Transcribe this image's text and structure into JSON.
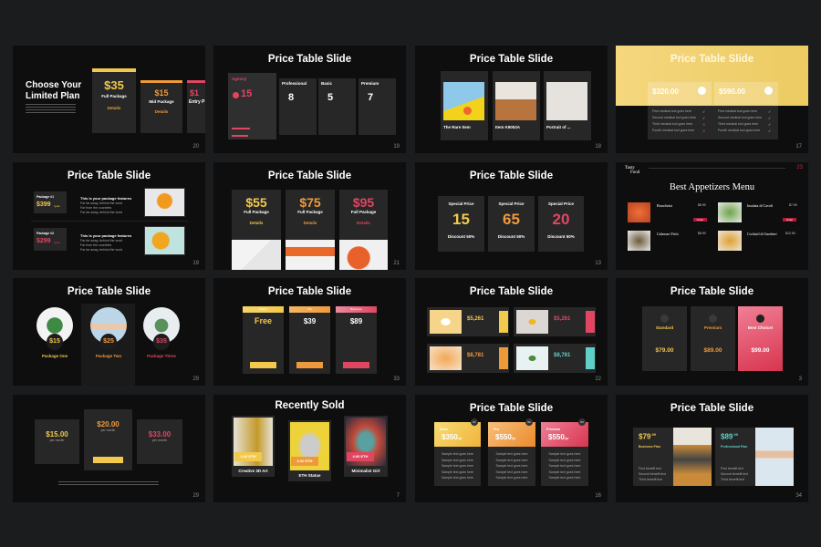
{
  "colors": {
    "background": "#1b1c1e",
    "slide": "#0e0e0f",
    "card": "#272728",
    "yellow": "#f2c94c",
    "orange": "#ef9a3a",
    "pink": "#e04662",
    "teal": "#5fd0c8"
  },
  "slides": [
    {
      "page_number": "20",
      "title_line1": "Choose Your",
      "title_line2": "Limited Plan",
      "plans": [
        {
          "price": "$35",
          "name": "Full Package",
          "link": "Details"
        },
        {
          "price": "$15",
          "name": "Mid Package",
          "link": "Details"
        },
        {
          "price": "$1",
          "name": "Entry P",
          "link": "D"
        }
      ]
    },
    {
      "page_number": "19",
      "title": "Price Table Slide",
      "agency": {
        "label": "Agency",
        "price": "15"
      },
      "plans": [
        {
          "name": "Professional",
          "price": "8"
        },
        {
          "name": "Basic",
          "price": "5"
        },
        {
          "name": "Premium",
          "price": "7"
        }
      ]
    },
    {
      "page_number": "18",
      "title": "Price Table Slide",
      "items": [
        {
          "name": "The Rare Item"
        },
        {
          "name": "Item K9053A"
        },
        {
          "name": "Portrait of ..."
        }
      ]
    },
    {
      "page_number": "17",
      "title": "Price Table Slide",
      "prices": [
        "$320.00",
        "$590.00"
      ],
      "features": [
        "First medical tool goes here",
        "Second medical tool goes here",
        "Third medical tool goes here",
        "Fourth medical tool goes here"
      ],
      "check_icon": "check-icon"
    },
    {
      "page_number": "19",
      "title": "Price Table Slide",
      "heading": "This is your package features",
      "bullets": [
        "Far far away, behind the word",
        "Far from the countries",
        "Far far away, behind the word"
      ],
      "packages": [
        {
          "label": "Package #1",
          "price": "$399",
          "period": "/year"
        },
        {
          "label": "Package #2",
          "price": "$299",
          "period": "/year"
        }
      ]
    },
    {
      "page_number": "21",
      "title": "Price Table Slide",
      "plans": [
        {
          "price": "$55",
          "name": "Full Package",
          "link": "Details"
        },
        {
          "price": "$75",
          "name": "Full Package",
          "link": "Details"
        },
        {
          "price": "$95",
          "name": "Full Package",
          "link": "Details"
        }
      ]
    },
    {
      "page_number": "13",
      "title": "Price Table Slide",
      "label": "Special Price",
      "discount": "Discount 50%",
      "values": [
        "15",
        "65",
        "20"
      ]
    },
    {
      "page_number": "23",
      "brand_line1": "Tasty",
      "brand_line2": "Food",
      "title": "Best Appetizers Menu",
      "order_label": "Order",
      "items": [
        {
          "name": "Bruschetta",
          "price": "$8.90"
        },
        {
          "name": "Insalata di Cavoli",
          "price": "$7.90"
        },
        {
          "name": "Calamari Fritti",
          "price": "$8.90"
        },
        {
          "name": "Cocktail di Gamberi",
          "price": "$12.90"
        }
      ]
    },
    {
      "page_number": "29",
      "title": "Price Table Slide",
      "packages": [
        {
          "name": "Package One",
          "price": "$15"
        },
        {
          "name": "Package Two",
          "price": "$25"
        },
        {
          "name": "Package Three",
          "price": "$35"
        }
      ]
    },
    {
      "page_number": "33",
      "title": "Price Table Slide",
      "tiers": [
        {
          "name": "Starter",
          "price": "Free"
        },
        {
          "name": "Pro",
          "price": "$39"
        },
        {
          "name": "Business",
          "price": "$89"
        }
      ]
    },
    {
      "page_number": "22",
      "title": "Price Table Slide",
      "prices": [
        "$5,261",
        "$5,261",
        "$8,781",
        "$8,781"
      ]
    },
    {
      "page_number": "3",
      "title": "Price Table Slide",
      "plans": [
        {
          "name": "Standard",
          "price": "$79.00"
        },
        {
          "name": "Premium",
          "price": "$89.00"
        },
        {
          "name": "Best Choice!",
          "price": "$99.00"
        }
      ]
    },
    {
      "page_number": "29",
      "plans": [
        {
          "price": "$15.00",
          "period": "per month"
        },
        {
          "price": "$20.00",
          "period": "per month"
        },
        {
          "price": "$33.00",
          "period": "per month"
        }
      ]
    },
    {
      "page_number": "7",
      "title": "Recently Sold",
      "items": [
        {
          "name": "Creative 3D Art",
          "price": "2.00 ETH"
        },
        {
          "name": "ETH Statue",
          "price": "8.00 ETH"
        },
        {
          "name": "Minimalist Girl",
          "price": "4.00 ETH"
        }
      ]
    },
    {
      "page_number": "16",
      "title": "Price Table Slide",
      "row_text": "Sample text goes here",
      "plans": [
        {
          "name": "Basic",
          "price": "$350",
          "period": "/yr",
          "badge": "01"
        },
        {
          "name": "Pro",
          "price": "$550",
          "period": "/yr",
          "badge": "02"
        },
        {
          "name": "Premium",
          "price": "$550",
          "period": "/yr",
          "badge": "03"
        }
      ]
    },
    {
      "page_number": "34",
      "title": "Price Table Slide",
      "plans": [
        {
          "price": "$79",
          "cents": ".99",
          "name": "Business Plan"
        },
        {
          "price": "$89",
          "cents": ".99",
          "name": "Professional Plan"
        }
      ],
      "benefits": [
        "First benefit text",
        "Second benefit text",
        "Third benefit text"
      ]
    }
  ]
}
